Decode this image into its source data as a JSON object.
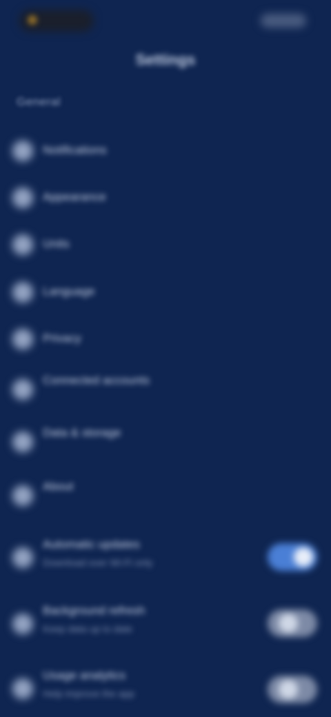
{
  "status_bar": {
    "time": "",
    "indicators": ""
  },
  "header": {
    "title": "Settings"
  },
  "section": {
    "title": "General"
  },
  "items": [
    {
      "label": "Notifications",
      "sub": "",
      "icon": "bell-icon"
    },
    {
      "label": "Appearance",
      "sub": "",
      "icon": "palette-icon"
    },
    {
      "label": "Units",
      "sub": "",
      "icon": "ruler-icon"
    },
    {
      "label": "Language",
      "sub": "",
      "icon": "globe-icon"
    },
    {
      "label": "Privacy",
      "sub": "",
      "icon": "lock-icon"
    },
    {
      "label": "Connected accounts",
      "sub": "",
      "icon": "link-icon"
    },
    {
      "label": "Data & storage",
      "sub": "",
      "icon": "database-icon"
    },
    {
      "label": "About",
      "sub": "",
      "icon": "info-icon"
    }
  ],
  "toggles": [
    {
      "label": "Automatic updates",
      "sub": "Download over Wi‑Fi only",
      "icon": "refresh-icon",
      "on": true
    },
    {
      "label": "Background refresh",
      "sub": "Keep data up to date",
      "icon": "sync-icon",
      "on": false
    },
    {
      "label": "Usage analytics",
      "sub": "Help improve the app",
      "icon": "chart-icon",
      "on": false
    }
  ]
}
